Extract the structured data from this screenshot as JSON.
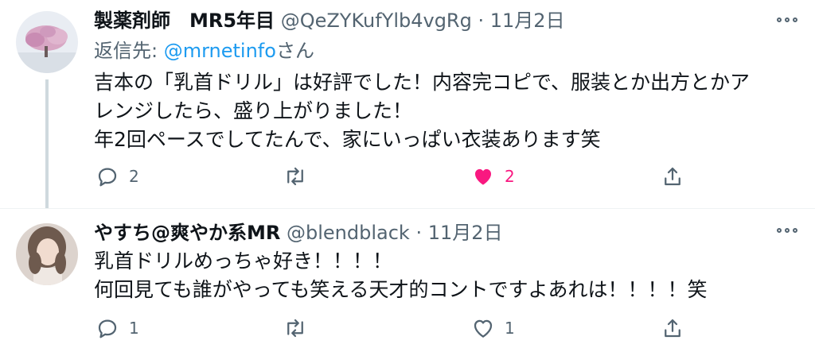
{
  "tweets": [
    {
      "name": "製薬剤師　MR5年目",
      "handle": "@QeZYKufYlb4vgRg",
      "date": "11月2日",
      "reply_prefix": "返信先: ",
      "reply_mention": "@mrnetinfo",
      "reply_suffix": "さん",
      "text": "吉本の「乳首ドリル」は好評でした！内容完コピで、服装とか出方とかアレンジしたら、盛り上がりました！\n年2回ペースでしてたんで、家にいっぱい衣装あります笑",
      "replies": "2",
      "retweets": "",
      "likes": "2",
      "liked": true,
      "avatar": "cherry-blossom-tree"
    },
    {
      "name": "やすち@爽やか系MR",
      "handle": "@blendblack",
      "date": "11月2日",
      "text": "乳首ドリルめっちゃ好き！！！！\n何回見ても誰がやっても笑える天才的コントですよあれは！！！！笑",
      "replies": "1",
      "retweets": "",
      "likes": "1",
      "liked": false,
      "avatar": "person-portrait"
    }
  ],
  "separator": "·",
  "colors": {
    "accent": "#1d9bf0",
    "like": "#f91880",
    "muted": "#536471",
    "text": "#0f1419"
  },
  "icons": [
    "reply-icon",
    "retweet-icon",
    "like-icon",
    "share-icon",
    "more-icon"
  ]
}
